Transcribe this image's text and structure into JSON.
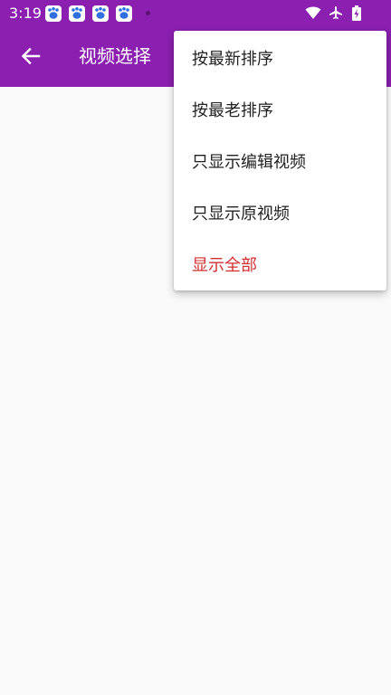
{
  "status_bar": {
    "time": "3:19",
    "notification_icons": [
      "baidu-paw-icon",
      "baidu-paw-icon",
      "baidu-paw-icon",
      "baidu-paw-icon"
    ],
    "right_icons": [
      "wifi-icon",
      "airplane-icon",
      "battery-charging-icon"
    ]
  },
  "app_bar": {
    "title": "视频选择",
    "back_icon": "arrow-left-icon"
  },
  "menu": {
    "items": [
      {
        "label": "按最新排序",
        "selected": false
      },
      {
        "label": "按最老排序",
        "selected": false
      },
      {
        "label": "只显示编辑视频",
        "selected": false
      },
      {
        "label": "只显示原视频",
        "selected": false
      },
      {
        "label": "显示全部",
        "selected": true
      }
    ]
  },
  "colors": {
    "primary": "#8a1fb0",
    "selected_text": "#d32f2f",
    "background": "#fafafa"
  }
}
